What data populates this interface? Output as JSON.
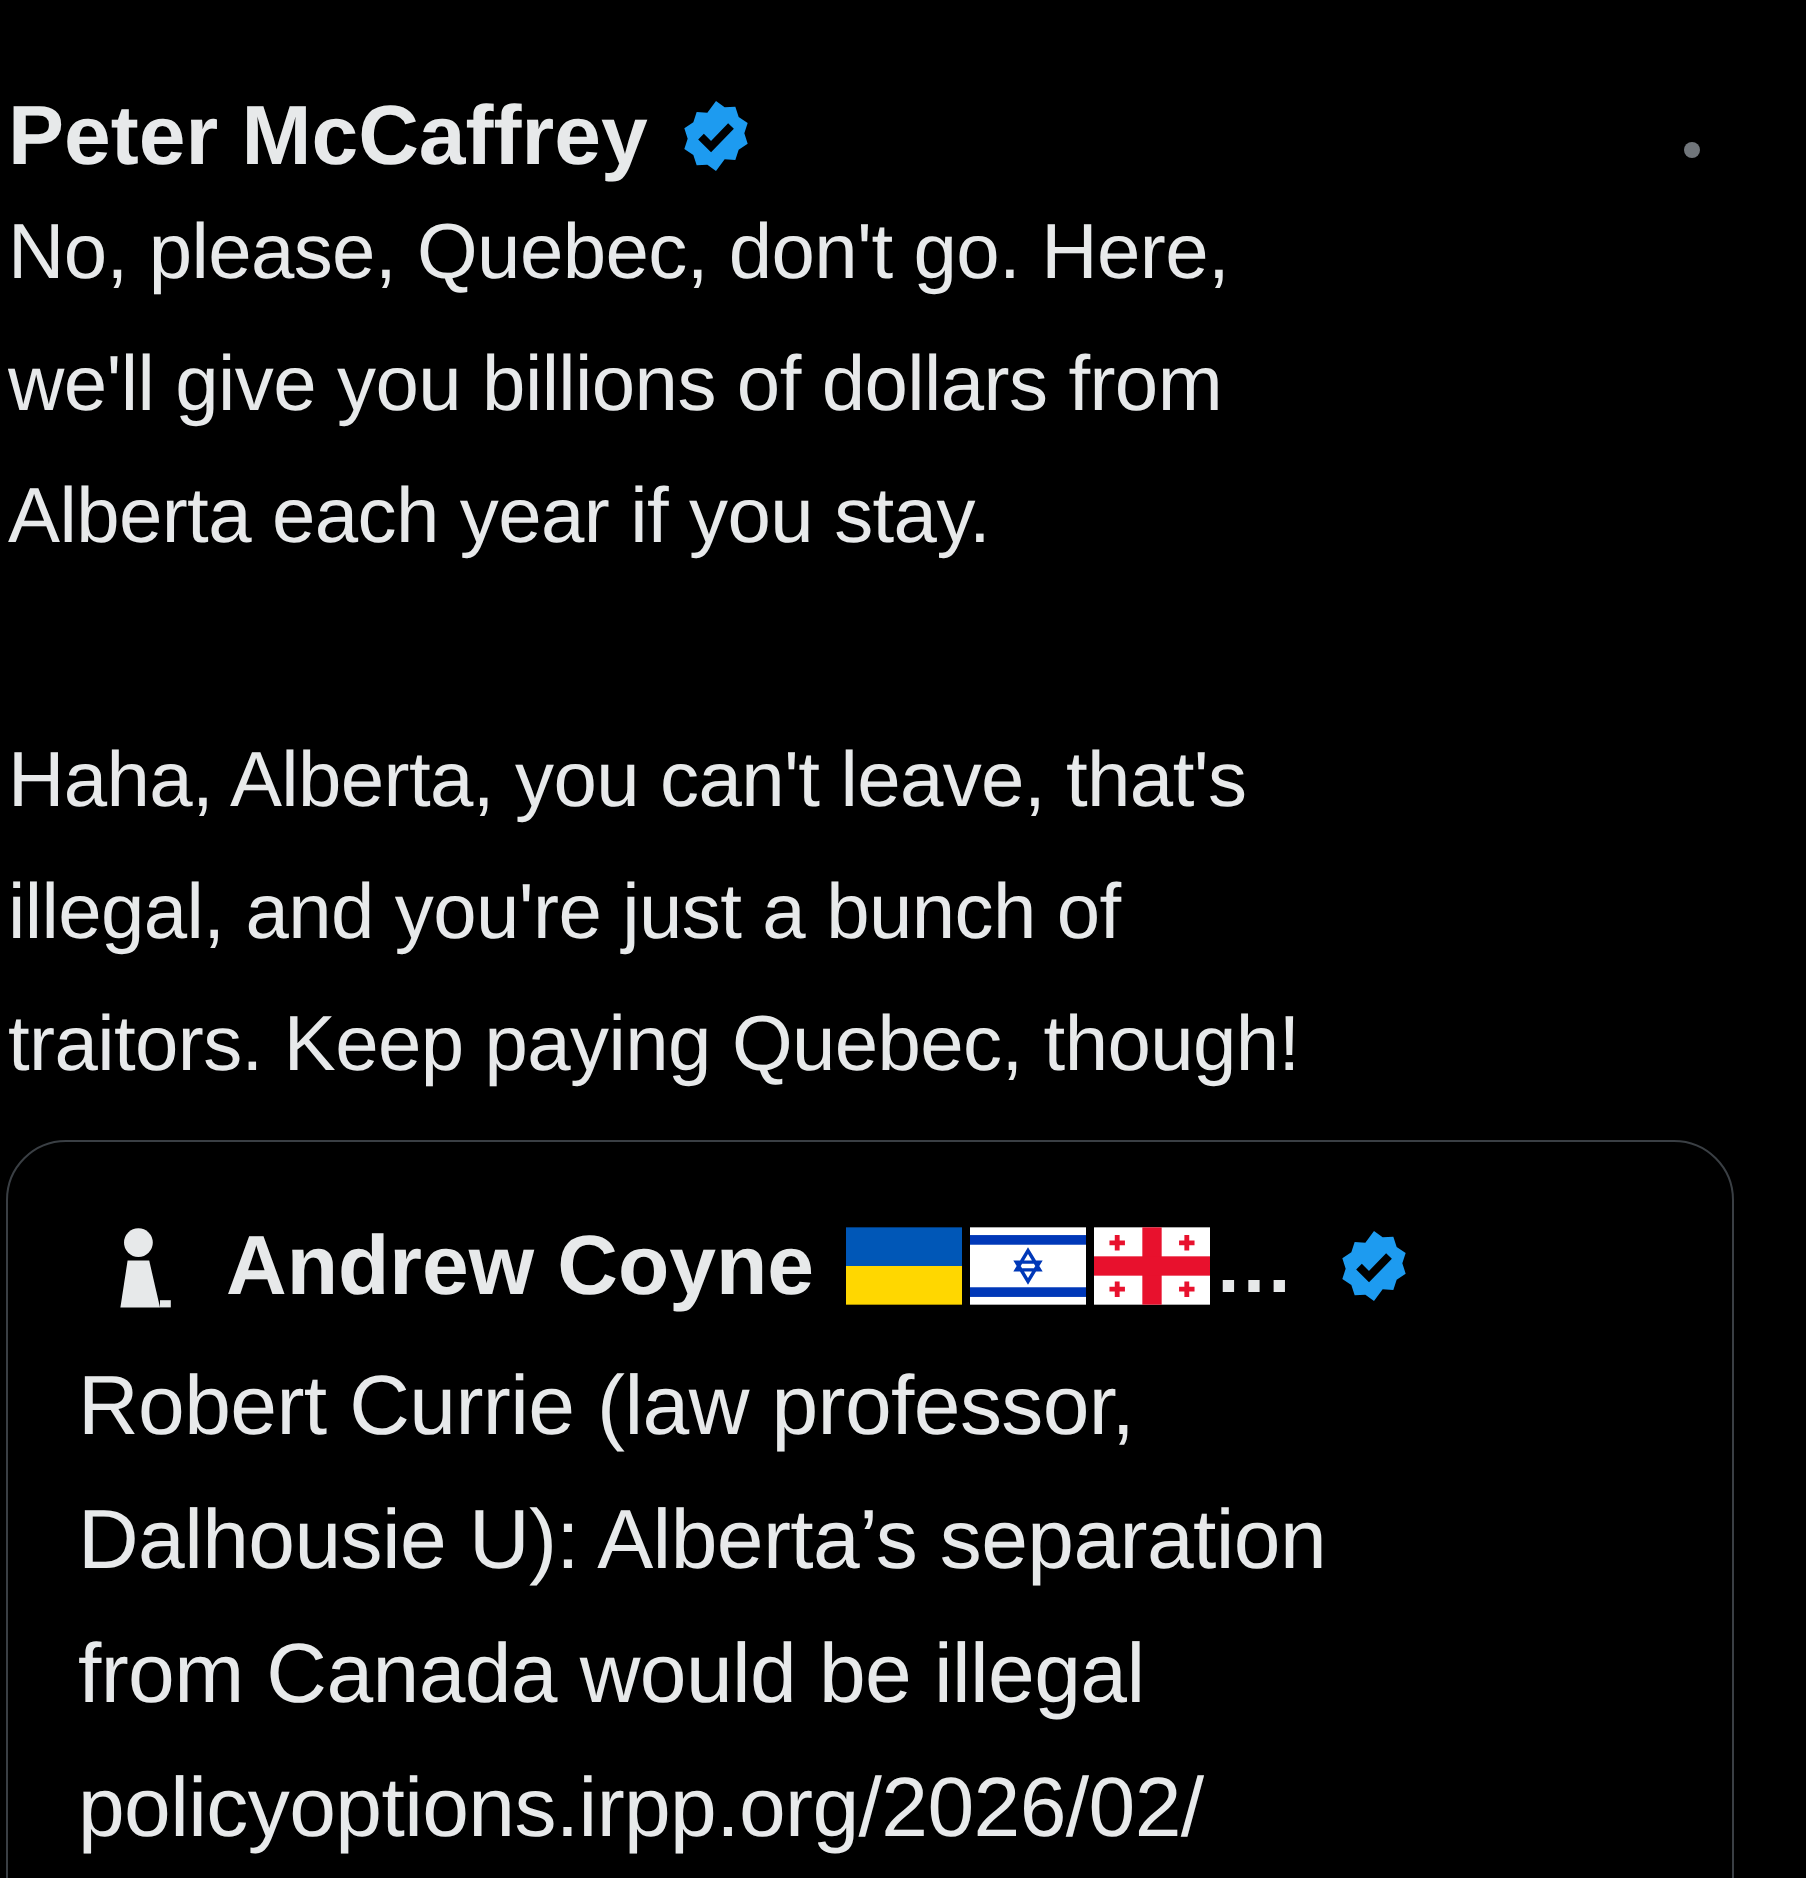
{
  "post": {
    "author": "Peter McCaffrey",
    "verified": true,
    "paragraphs": [
      "No, please, Quebec, don't go. Here,\nwe'll give you billions of dollars from\nAlberta each year if you stay.",
      "Haha, Alberta, you can't leave, that's\nillegal, and you're just a bunch of\ntraitors. Keep paying Quebec, though!"
    ]
  },
  "quote": {
    "author": "Andrew Coyne",
    "flags": [
      {
        "kind": "ukraine"
      },
      {
        "kind": "israel"
      },
      {
        "kind": "georgia"
      }
    ],
    "ellipsis": "…",
    "verified": true,
    "text": "Robert Currie (law professor,\nDalhousie U): Alberta’s separation\nfrom Canada would be illegal\npolicyoptions.irpp.org/2026/02/"
  }
}
